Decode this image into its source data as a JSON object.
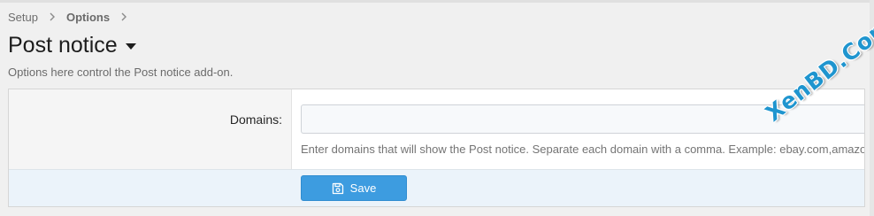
{
  "breadcrumb": {
    "items": [
      {
        "label": "Setup"
      },
      {
        "label": "Options"
      }
    ]
  },
  "header": {
    "title": "Post notice",
    "description": "Options here control the Post notice add-on."
  },
  "form": {
    "domains": {
      "label": "Domains:",
      "value": "",
      "hint": "Enter domains that will show the Post notice. Separate each domain with a comma. Example: ebay.com,amazon.com"
    },
    "save_label": "Save"
  },
  "watermark": {
    "text": "XenBD.Com"
  },
  "colors": {
    "accent": "#3d9ce0",
    "footer_bg": "#ebf3fa",
    "watermark": "#1f95cf"
  }
}
